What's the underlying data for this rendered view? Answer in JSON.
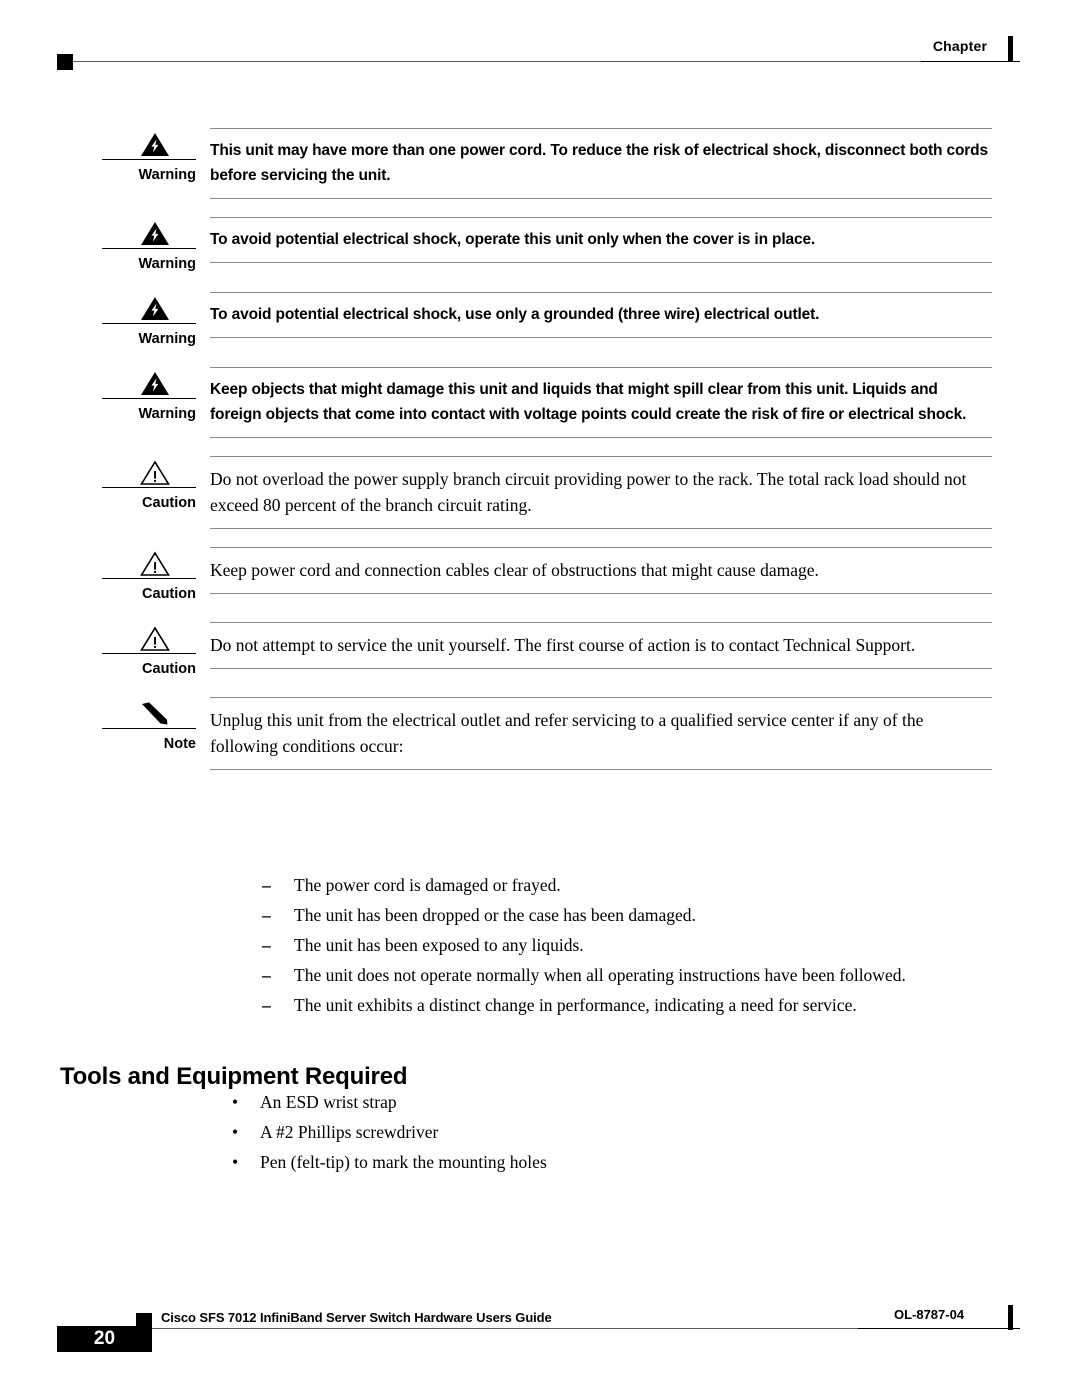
{
  "header": {
    "chapter_label": "Chapter",
    "marker_icon": "black-square-marker"
  },
  "admonitions": [
    {
      "kind": "warning",
      "label": "Warning",
      "icon": "warning-lightning-triangle-icon",
      "text": "This unit may have more than one power cord. To reduce the risk of electrical shock, disconnect both cords before servicing the unit."
    },
    {
      "kind": "warning",
      "label": "Warning",
      "icon": "warning-lightning-triangle-icon",
      "text": "To avoid potential electrical shock, operate this unit only when the cover is in place."
    },
    {
      "kind": "warning",
      "label": "Warning",
      "icon": "warning-lightning-triangle-icon",
      "text": "To avoid potential electrical shock, use only a grounded (three wire) electrical outlet."
    },
    {
      "kind": "warning",
      "label": "Warning",
      "icon": "warning-lightning-triangle-icon",
      "text": "Keep objects that might damage this unit and liquids that might spill clear from this unit. Liquids and foreign objects that come into contact with voltage points could create the risk of fire or electrical shock."
    },
    {
      "kind": "caution",
      "label": "Caution",
      "icon": "caution-exclamation-triangle-icon",
      "text": "Do not overload the power supply branch circuit providing power to the rack. The total rack load should not exceed 80 percent of the branch circuit rating."
    },
    {
      "kind": "caution",
      "label": "Caution",
      "icon": "caution-exclamation-triangle-icon",
      "text": "Keep power cord and connection cables clear of obstructions that might cause damage."
    },
    {
      "kind": "caution",
      "label": "Caution",
      "icon": "caution-exclamation-triangle-icon",
      "text": "Do not attempt to service the unit yourself. The first course of action is to contact Technical Support."
    },
    {
      "kind": "note",
      "label": "Note",
      "icon": "note-pencil-icon",
      "text": "Unplug this unit from the electrical outlet and refer servicing to a qualified service center if any of the following conditions occur:"
    }
  ],
  "conditions_list": {
    "marker": "–",
    "items": [
      "The power cord is damaged or frayed.",
      "The unit has been dropped or the case has been damaged.",
      "The unit has been exposed to any liquids.",
      "The unit does not operate normally when all operating instructions have been followed.",
      "The unit exhibits a distinct change in performance, indicating a need for service."
    ]
  },
  "section": {
    "heading": "Tools and Equipment Required",
    "bullet_marker": "•",
    "items": [
      "An ESD wrist strap",
      "A #2 Phillips screwdriver",
      "Pen (felt-tip) to mark the mounting holes"
    ]
  },
  "footer": {
    "page_number": "20",
    "document_title": "Cisco SFS 7012 InfiniBand Server Switch Hardware Users Guide",
    "doc_id": "OL-8787-04",
    "marker_icon": "black-square-marker"
  }
}
